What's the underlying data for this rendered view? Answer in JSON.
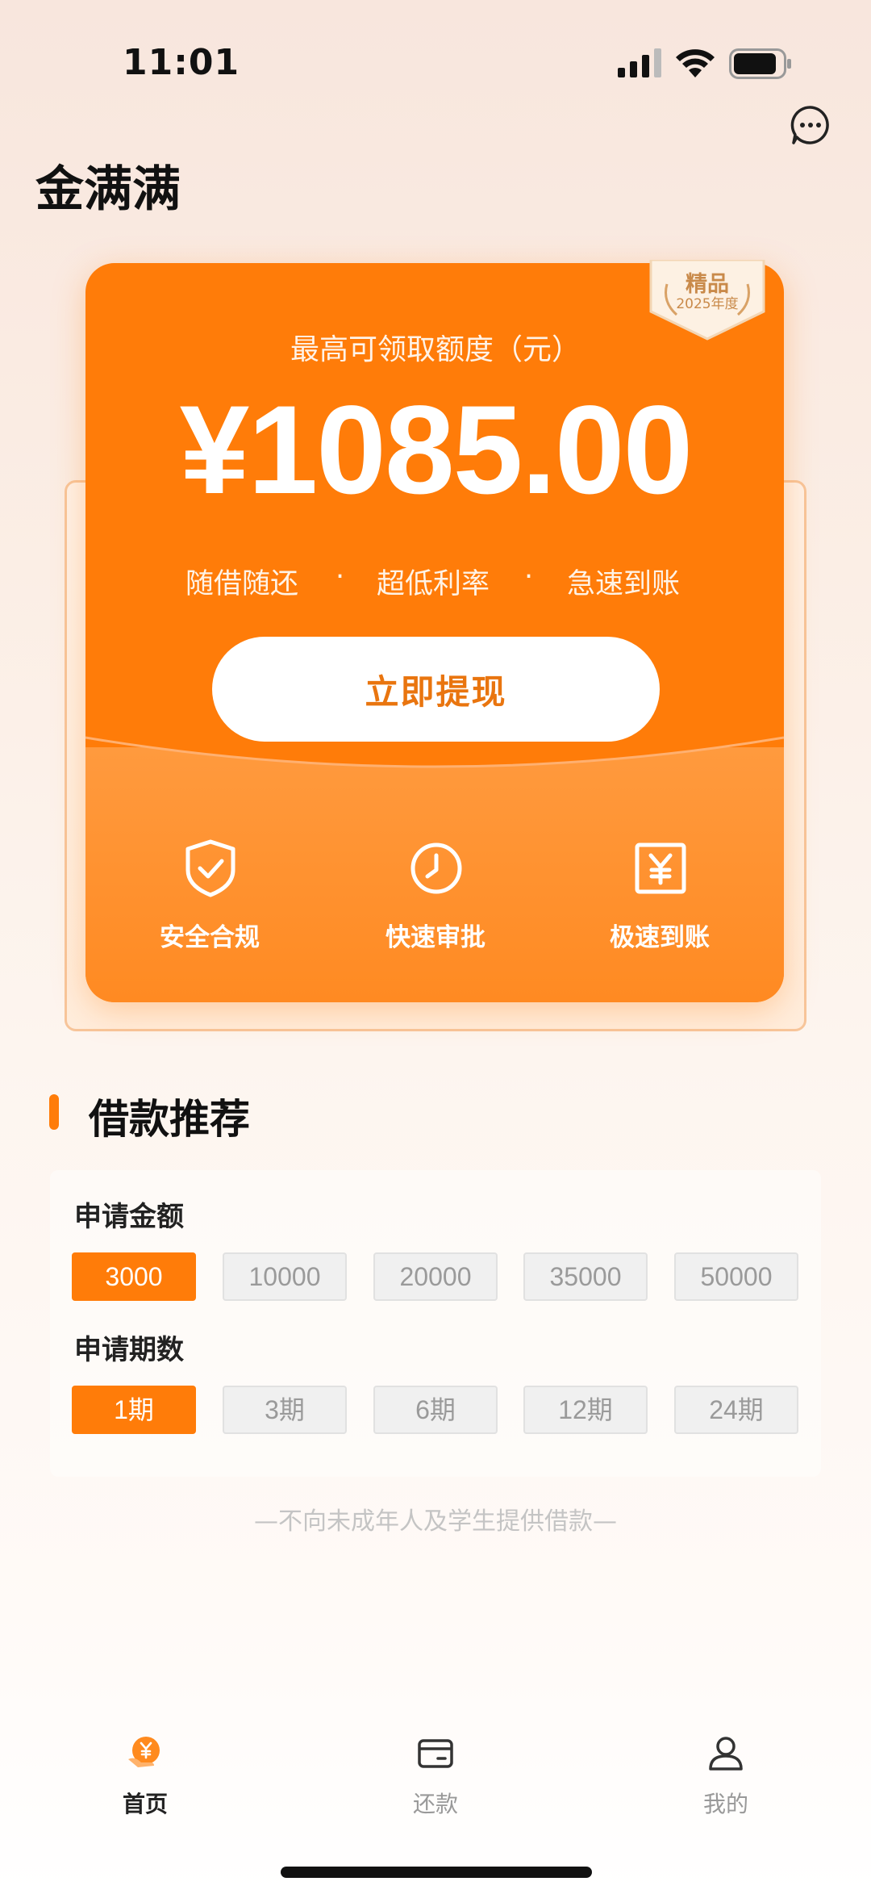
{
  "status_bar": {
    "time": "11:01"
  },
  "header": {
    "title": "金满满"
  },
  "card": {
    "badge": {
      "title": "精品",
      "year": "2025年度"
    },
    "quota_label": "最高可领取额度（元）",
    "quota_value": "¥1085.00",
    "features": [
      "随借随还",
      "·",
      "超低利率",
      "·",
      "急速到账"
    ],
    "withdraw_label": "立即提现",
    "perks": [
      {
        "label": "安全合规",
        "icon": "shield-check-icon"
      },
      {
        "label": "快速审批",
        "icon": "clock-icon"
      },
      {
        "label": "极速到账",
        "icon": "yuan-icon"
      }
    ]
  },
  "recommend": {
    "title": "借款推荐",
    "amount_label": "申请金额",
    "amounts": [
      "3000",
      "10000",
      "20000",
      "35000",
      "50000"
    ],
    "selected_amount": "3000",
    "period_label": "申请期数",
    "periods": [
      "1期",
      "3期",
      "6期",
      "12期",
      "24期"
    ],
    "selected_period": "1期"
  },
  "disclaimer": "—不向未成年人及学生提供借款—",
  "bottom_nav": {
    "items": [
      {
        "label": "首页",
        "icon": "home-yuan-icon",
        "active": true
      },
      {
        "label": "还款",
        "icon": "card-icon",
        "active": false
      },
      {
        "label": "我的",
        "icon": "person-icon",
        "active": false
      }
    ]
  },
  "colors": {
    "accent": "#ff7c09",
    "accent_text": "#e9750f"
  }
}
